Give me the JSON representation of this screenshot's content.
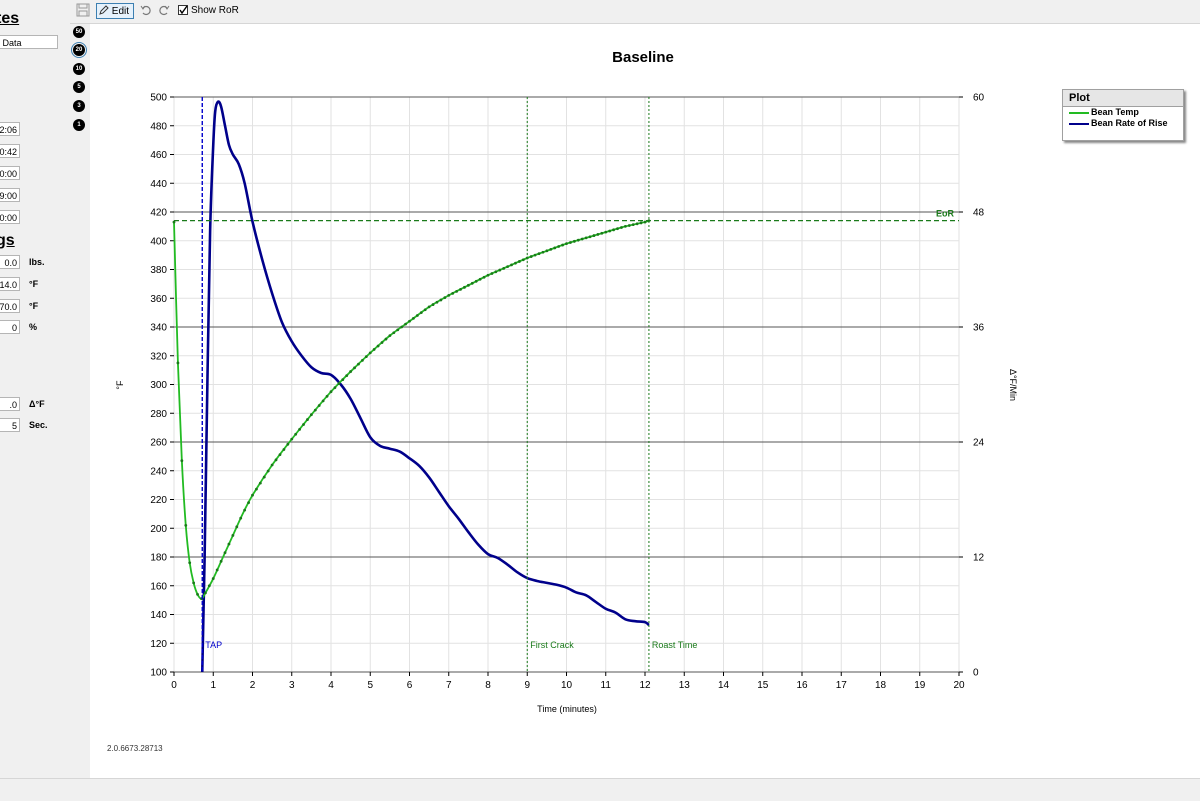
{
  "left_panel": {
    "heading_top": "tes",
    "data_field": "r Data",
    "time_fields": [
      "2:06",
      "0:42",
      "0:00",
      "9:00",
      "0:00"
    ],
    "heading_mid": "gs",
    "settings_rows": [
      {
        "value": "0.0",
        "unit": "lbs."
      },
      {
        "value": "14.0",
        "unit": "°F"
      },
      {
        "value": "70.0",
        "unit": "°F"
      },
      {
        "value": "0",
        "unit": "%"
      }
    ],
    "ror_rows": [
      {
        "value": ".0",
        "unit": "Δ°F"
      },
      {
        "value": "5",
        "unit": "Sec."
      }
    ]
  },
  "zoom_buttons": [
    "50",
    "20",
    "10",
    "5",
    "3",
    "1"
  ],
  "toolbar": {
    "edit_label": "Edit",
    "show_ror_label": "Show RoR"
  },
  "version": "2.0.6673.28713",
  "legend": {
    "title": "Plot",
    "items": [
      {
        "name": "Bean Temp",
        "color": "#22bb22"
      },
      {
        "name": "Bean Rate of Rise",
        "color": "#00008b"
      }
    ]
  },
  "chart_data": {
    "type": "line",
    "title": "Baseline",
    "xlabel": "Time (minutes)",
    "ylabel": "°F",
    "y2label": "Δ°F/Min",
    "xlim": [
      0,
      20
    ],
    "ylim": [
      100,
      500
    ],
    "y2lim": [
      0,
      60
    ],
    "x_ticks": [
      "0",
      "1",
      "2",
      "3",
      "4",
      "5",
      "6",
      "7",
      "8",
      "9",
      "10",
      "11",
      "12",
      "13",
      "14",
      "15",
      "16",
      "17",
      "18",
      "19",
      "20"
    ],
    "y_ticks": [
      "100",
      "120",
      "140",
      "160",
      "180",
      "200",
      "220",
      "240",
      "260",
      "280",
      "300",
      "320",
      "340",
      "360",
      "380",
      "400",
      "420",
      "440",
      "460",
      "480",
      "500"
    ],
    "y2_ticks": [
      "0",
      "12",
      "24",
      "36",
      "48",
      "60"
    ],
    "grid": true,
    "colors": {
      "bean_temp": "#22bb22",
      "ror": "#00008b",
      "markers": "#1a7a1a"
    },
    "series": [
      {
        "name": "Bean Temp",
        "axis": "left",
        "x": [
          0,
          0.1,
          0.2,
          0.3,
          0.4,
          0.5,
          0.6,
          0.7,
          0.8,
          1,
          1.25,
          1.5,
          1.75,
          2,
          2.5,
          3,
          3.5,
          4,
          4.5,
          5,
          5.5,
          6,
          6.5,
          7,
          7.5,
          8,
          8.5,
          9,
          9.5,
          10,
          10.5,
          11,
          11.5,
          12,
          12.1
        ],
        "y": [
          413,
          315,
          247,
          202,
          176,
          162,
          154,
          151,
          155,
          165,
          180,
          195,
          210,
          223,
          244,
          262,
          279,
          295,
          309,
          322,
          334,
          344,
          354,
          362,
          369,
          376,
          382,
          388,
          393,
          398,
          402,
          406,
          410,
          413,
          414
        ]
      },
      {
        "name": "Bean Rate of Rise",
        "axis": "right",
        "x": [
          0.72,
          0.78,
          0.85,
          0.92,
          1.0,
          1.05,
          1.12,
          1.2,
          1.3,
          1.4,
          1.5,
          1.65,
          1.8,
          2.0,
          2.25,
          2.5,
          2.75,
          3.0,
          3.25,
          3.5,
          3.75,
          4.0,
          4.25,
          4.5,
          4.75,
          5.0,
          5.25,
          5.5,
          5.75,
          6.0,
          6.25,
          6.5,
          6.75,
          7.0,
          7.25,
          7.5,
          7.75,
          8.0,
          8.25,
          8.5,
          8.75,
          9.0,
          9.25,
          9.5,
          9.75,
          10.0,
          10.25,
          10.5,
          10.75,
          11.0,
          11.25,
          11.5,
          11.75,
          12.0,
          12.1
        ],
        "y": [
          0,
          12,
          30,
          46,
          55,
          58.5,
          59.5,
          59,
          57,
          55,
          54,
          53,
          51,
          47,
          43,
          39.5,
          36.5,
          34.5,
          33,
          31.8,
          31.2,
          31,
          30,
          28.5,
          26.5,
          24.5,
          23.6,
          23.3,
          23,
          22.3,
          21.5,
          20.3,
          18.8,
          17.3,
          16,
          14.6,
          13.3,
          12.3,
          11.9,
          11.2,
          10.4,
          9.8,
          9.5,
          9.3,
          9.1,
          8.8,
          8.3,
          8.0,
          7.3,
          6.6,
          6.2,
          5.5,
          5.3,
          5.2,
          4.9
        ]
      }
    ],
    "events": [
      {
        "label": "TAP",
        "x": 0.72,
        "color": "#0000cc"
      },
      {
        "label": "First Crack",
        "x": 9.0,
        "color": "#1a7a1a"
      },
      {
        "label": "Roast Time",
        "x": 12.1,
        "color": "#1a7a1a"
      }
    ],
    "eor": {
      "label": "EoR",
      "y": 414,
      "color": "#1a7a1a"
    }
  }
}
